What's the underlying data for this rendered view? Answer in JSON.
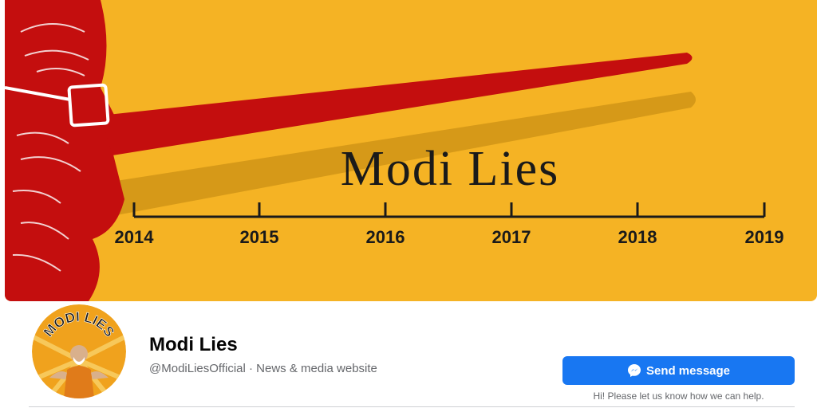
{
  "cover": {
    "title": "Modi Lies",
    "years": [
      "2014",
      "2015",
      "2016",
      "2017",
      "2018",
      "2019"
    ],
    "colors": {
      "background": "#f5b324",
      "nose": "#c40e0e",
      "ink": "#1a1a1a"
    }
  },
  "avatar": {
    "text": "MODI LIES"
  },
  "page": {
    "name": "Modi Lies",
    "handle_category": "@ModiLiesOfficial · News & media website"
  },
  "actions": {
    "send_message_label": "Send message",
    "send_message_icon": "messenger-icon",
    "send_hint": "Hi! Please let us know how we can help."
  },
  "colors": {
    "accent": "#1877f2"
  }
}
